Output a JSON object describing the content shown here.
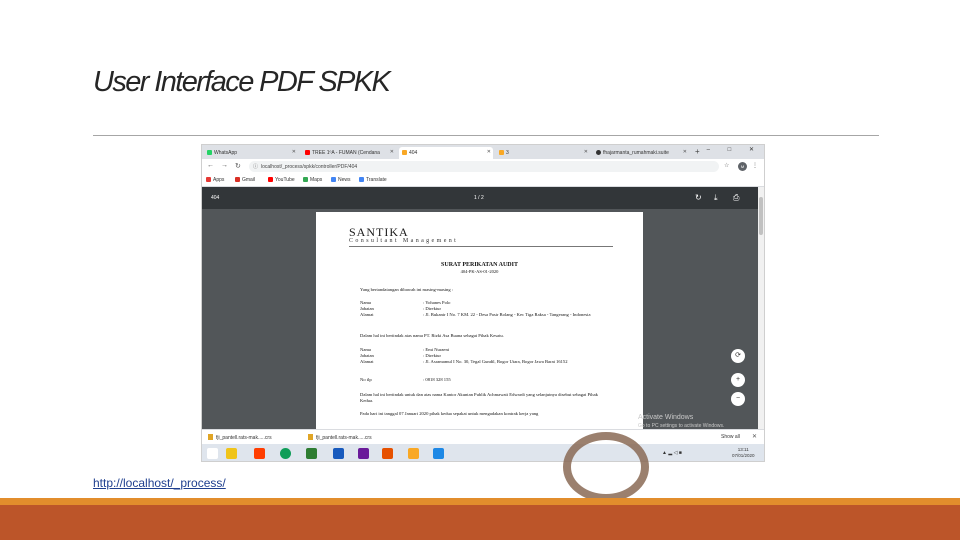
{
  "slide": {
    "title": "User Interface PDF SPKK",
    "link": "http://localhost/_process/"
  },
  "browser": {
    "tabs": [
      {
        "label": "WhatsApp",
        "color": "#25d366"
      },
      {
        "label": "TREE 1ºA - FUMAN (Cendana",
        "color": "#ff0000"
      },
      {
        "label": "404",
        "color": "#f9a825"
      },
      {
        "label": "3",
        "color": "#f9a825"
      },
      {
        "label": "fhajarmanta_rumahmaki.suite",
        "color": "#333333"
      }
    ],
    "new_tab": "+",
    "window_controls": "– □ ✕",
    "url": "localhost/_process/spkk/controller/PDF/404",
    "avatar": "M",
    "bookmarks": [
      {
        "label": "Apps",
        "color": "#e53935"
      },
      {
        "label": "Gmail",
        "color": "#d93025"
      },
      {
        "label": "YouTube",
        "color": "#ff0000"
      },
      {
        "label": "Maps",
        "color": "#34a853"
      },
      {
        "label": "News",
        "color": "#4285f4"
      },
      {
        "label": "Translate",
        "color": "#4285f4"
      }
    ]
  },
  "pdf": {
    "name": "404",
    "pages": "1 / 2"
  },
  "document": {
    "brand": "SANTIKA",
    "brand_sub": "Consultant Management",
    "title": "SURAT PERIKATAN AUDIT",
    "number": "404-PK-AS-01-2020",
    "intro": "Yang bertandatangan dibawah ini masing-masing :",
    "party1": [
      {
        "k": "Nama",
        "v": ": Yohanes Polo"
      },
      {
        "k": "Jabatan",
        "v": ": Direktur"
      },
      {
        "k": "Alamat",
        "v": ": Jl. Bukanir I No. 7 KM. 22 - Desa Pasir Bolang - Kec Tiga Raksa - Tangerang - Indonesia"
      }
    ],
    "party1_note": "Dalam hal ini bertindak atas nama PT. Rizki Asa Buana sebagai Pihak Kesatu.",
    "party2": [
      {
        "k": "Nama",
        "v": ": Emi Nuraeni"
      },
      {
        "k": "Jabatan",
        "v": ": Direktur"
      },
      {
        "k": "Alamat",
        "v": ": Jl. Asramamul I No. 30, Tegal Gundil, Bogor Utara, Bogor Jawa Barat 16152"
      },
      {
        "k": "No tlp",
        "v": ": 0818 328 155"
      }
    ],
    "party2_note": "Dalam hal ini bertindak untuk dan atas nama Kantor Akuntan Publik Achmawati Edwardi yang selanjutnya disebut sebagai Pihak Kedua.",
    "closing": "Pada hari ini tanggal 07 Januari 2020 pihak kedua sepakat untuk mengadakan kontrak kerja yang"
  },
  "watermark": {
    "line1": "Activate Windows",
    "line2": "Go to PC settings to activate Windows."
  },
  "downloads": {
    "items": [
      "fji_pantell.rats-mak.....crs",
      "fji_pantell.rats-mak.....crs"
    ],
    "show_all": "Show all",
    "close": "✕"
  },
  "taskbar": {
    "icons": [
      "#ffffff",
      "#f0c419",
      "#ff3d00",
      "#0078d7",
      "#2e7d32",
      "#0f9d58",
      "#185abd",
      "#6a1b9a",
      "#e65100",
      "#f9a825",
      "#1e88e5"
    ],
    "tray": "▲ ▂ ◁ ■",
    "time": "13:11",
    "date": "07/01/2020"
  }
}
